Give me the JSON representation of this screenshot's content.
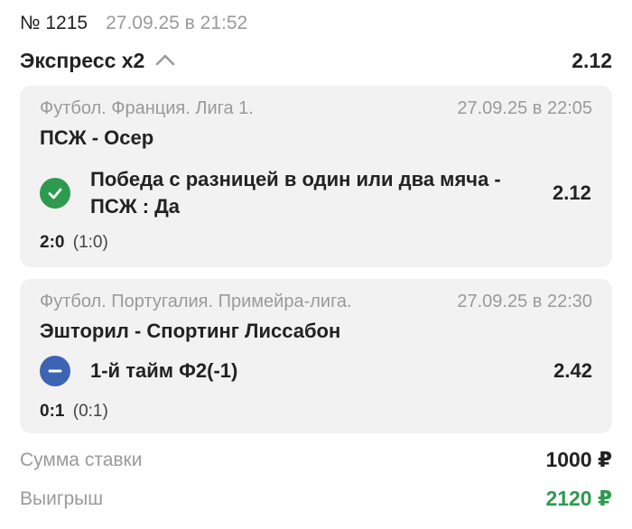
{
  "header": {
    "bet_number": "№ 1215",
    "datetime": "27.09.25 в 21:52"
  },
  "express": {
    "title": "Экспресс х2",
    "odds": "2.12",
    "expanded": true
  },
  "events": [
    {
      "league": "Футбол. Франция. Лига 1.",
      "datetime": "27.09.25 в 22:05",
      "teams": "ПСЖ - Осер",
      "bet": "Победа с разницей в один или два мяча - ПСЖ : Да",
      "odds": "2.12",
      "status": "won",
      "status_icon": "check-circle-icon",
      "score": "2:0",
      "half_score": "(1:0)"
    },
    {
      "league": "Футбол. Португалия. Примейра-лига.",
      "datetime": "27.09.25 в 22:30",
      "teams": "Эшторил - Спортинг Лиссабон",
      "bet": "1-й тайм Ф2(-1)",
      "odds": "2.42",
      "status": "void",
      "status_icon": "minus-circle-icon",
      "score": "0:1",
      "half_score": "(0:1)"
    }
  ],
  "summary": {
    "stake_label": "Сумма ставки",
    "stake_value": "1000 ₽",
    "win_label": "Выигрыш",
    "win_value": "2120 ₽"
  },
  "colors": {
    "win_green": "#2e9a4f",
    "void_blue": "#3d63b5",
    "card_bg": "#f2f2f2",
    "muted_text": "#9a9a9a"
  }
}
